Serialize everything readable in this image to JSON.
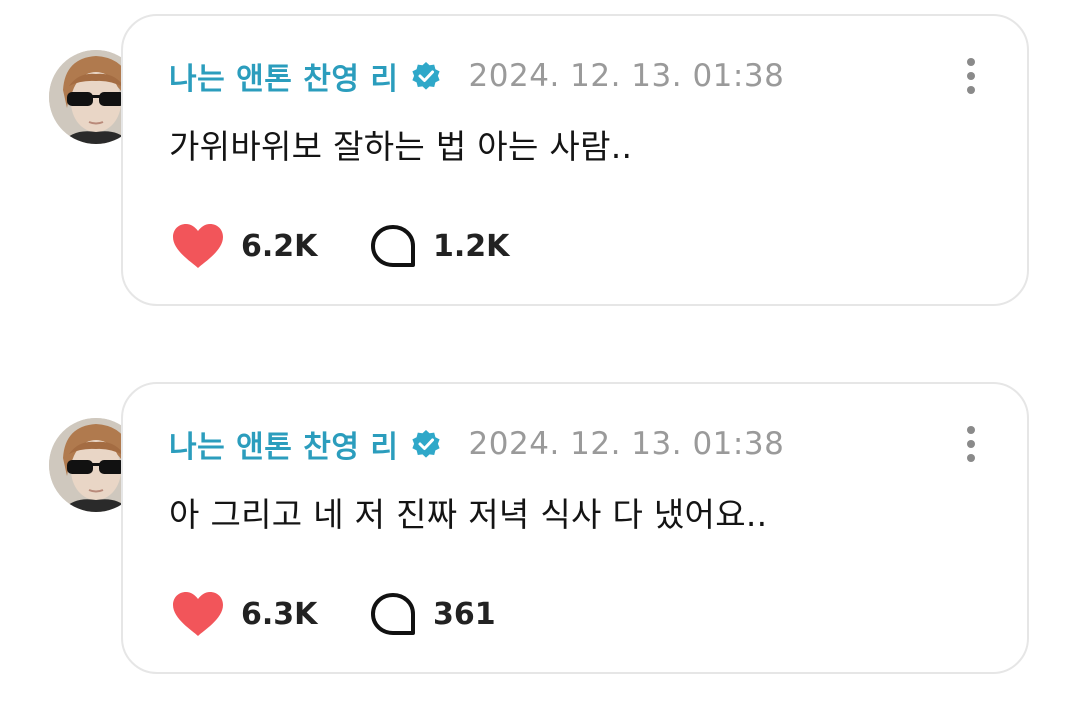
{
  "colors": {
    "username": "#2b9dbd",
    "verified_badge": "#2fa8c9",
    "timestamp": "#9a9a9a",
    "heart": "#f2555a",
    "text": "#141414",
    "card_border": "#e6e6e6"
  },
  "posts": [
    {
      "author": "나는 앤톤 찬영 리",
      "verified_icon": "verified-badge-icon",
      "timestamp": "2024. 12. 13. 01:38",
      "text": "가위바위보 잘하는 법 아는 사람..",
      "likes": "6.2K",
      "comments": "1.2K",
      "like_icon": "heart-icon",
      "comment_icon": "comment-bubble-icon",
      "menu_icon": "more-vertical-icon"
    },
    {
      "author": "나는 앤톤 찬영 리",
      "verified_icon": "verified-badge-icon",
      "timestamp": "2024. 12. 13. 01:38",
      "text": "아 그리고 네 저 진짜 저녁 식사 다 냈어요..",
      "likes": "6.3K",
      "comments": "361",
      "like_icon": "heart-icon",
      "comment_icon": "comment-bubble-icon",
      "menu_icon": "more-vertical-icon"
    }
  ]
}
